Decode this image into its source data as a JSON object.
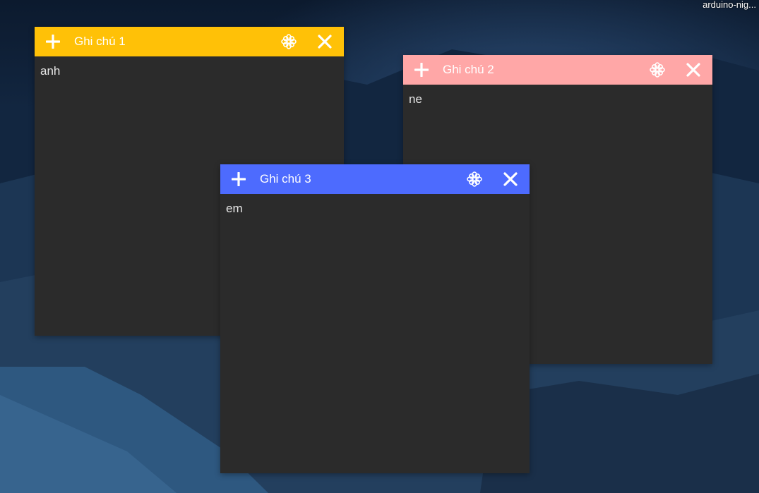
{
  "desktop": {
    "label": "arduino-nig..."
  },
  "notes": [
    {
      "title": "Ghi chú 1",
      "content": "anh",
      "color": "#ffc107"
    },
    {
      "title": "Ghi chú 2",
      "content": "ne",
      "color": "#ffa7a7"
    },
    {
      "title": "Ghi chú 3",
      "content": "em",
      "color": "#4d6bfe"
    }
  ],
  "icons": {
    "add": "plus-icon",
    "settings": "flower-settings-icon",
    "close": "close-icon"
  }
}
